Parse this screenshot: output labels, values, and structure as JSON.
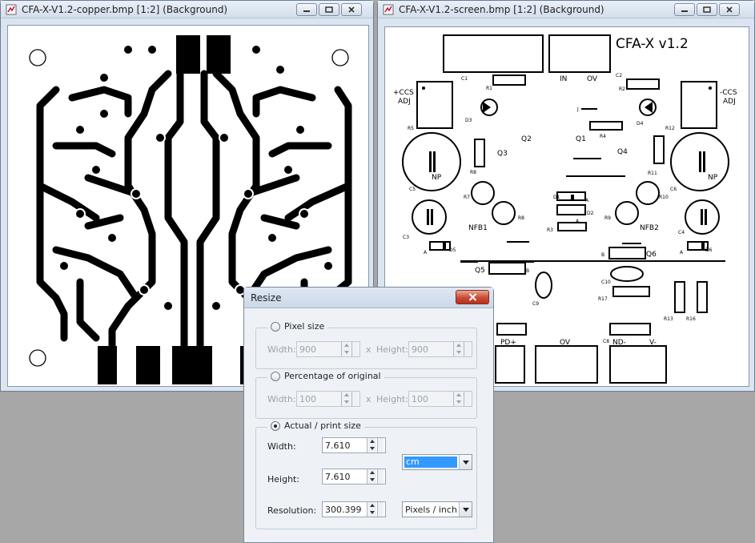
{
  "copper_window": {
    "title": "CFA-X-V1.2-copper.bmp [1:2] (Background)"
  },
  "screen_window": {
    "title": "CFA-X-V1.2-screen.bmp [1:2] (Background)"
  },
  "silkscreen": {
    "heading": "CFA-X v1.2",
    "labels": {
      "c1": "C1",
      "c2": "C2",
      "r1": "R1",
      "r2": "R2",
      "in": "IN",
      "ov_top": "OV",
      "ccs_left": "+CCS",
      "adj_left": "ADJ",
      "ccs_right": "-CCS",
      "adj_right": "ADJ",
      "r5": "R5",
      "r12": "R12",
      "d3": "D3",
      "d4": "D4",
      "r4": "R4",
      "q1": "Q1",
      "q2": "Q2",
      "q3": "Q3",
      "q4": "Q4",
      "r8b": "R8",
      "r11": "R11",
      "np_left": "NP",
      "np_right": "NP",
      "c5": "C5",
      "c6": "C6",
      "r7": "R7",
      "r10": "R10",
      "d1": "D1",
      "d2": "D2",
      "r3": "R3",
      "r8": "R8",
      "r9": "R9",
      "nfb1": "NFB1",
      "nfb2": "NFB2",
      "c3": "C3",
      "c4": "C4",
      "d5": "D5",
      "d6": "D6",
      "a_left": "A",
      "a_right": "A",
      "a_d1": "A",
      "a_d2": "A",
      "b_q6": "B",
      "q6": "Q6",
      "q5": "Q5",
      "b_q5": "B",
      "c10": "C10",
      "r17": "R17",
      "c9": "C9",
      "r13": "R13",
      "r16": "R16",
      "c8": "C8",
      "j": "J",
      "pd_plus": "PD+",
      "ov_bottom": "OV",
      "nd_minus": "ND-",
      "v_minus": "V-"
    }
  },
  "resize_dialog": {
    "title": "Resize",
    "pixel_size": {
      "label": "Pixel size",
      "width_label": "Width:",
      "width_value": "900",
      "x_sep": "x",
      "height_label": "Height:",
      "height_value": "900"
    },
    "percentage": {
      "label": "Percentage of original",
      "width_label": "Width:",
      "width_value": "100",
      "x_sep": "x",
      "height_label": "Height:",
      "height_value": "100"
    },
    "print_size": {
      "label": "Actual / print size",
      "width_label": "Width:",
      "width_value": "7.610",
      "height_label": "Height:",
      "height_value": "7.610",
      "resolution_label": "Resolution:",
      "resolution_value": "300.399",
      "unit_value": "cm",
      "res_unit_value": "Pixels / inch"
    }
  },
  "colors": {
    "desktop": "#a7a7a7",
    "window_frame": "#dbe5f1",
    "selection": "#3399ff",
    "close_red": "#c84a33"
  }
}
